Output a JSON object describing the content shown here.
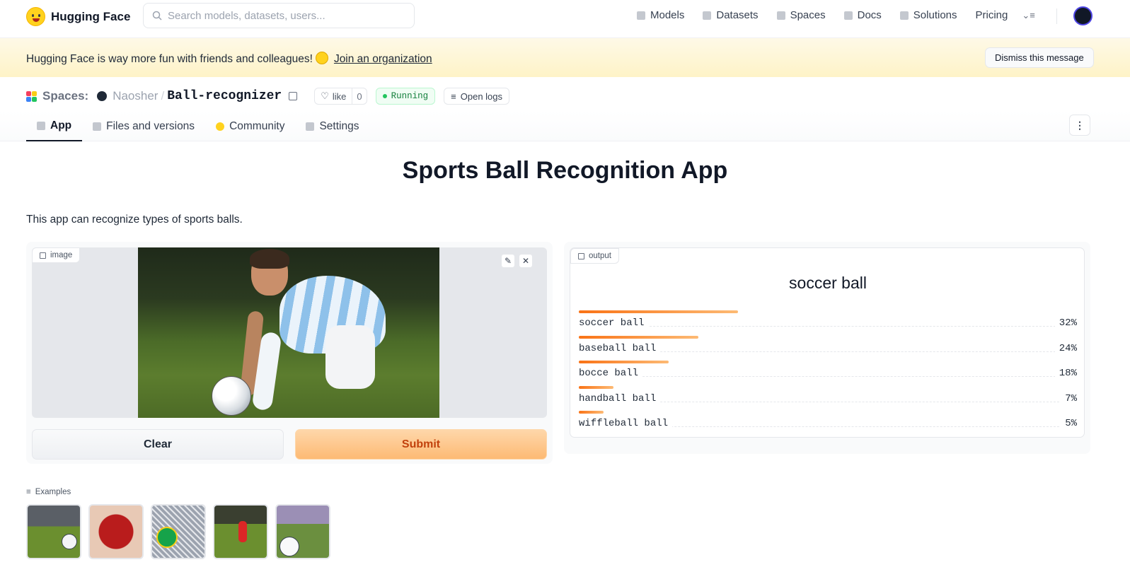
{
  "nav": {
    "brand": "Hugging Face",
    "search_placeholder": "Search models, datasets, users...",
    "links": [
      "Models",
      "Datasets",
      "Spaces",
      "Docs",
      "Solutions",
      "Pricing"
    ]
  },
  "banner": {
    "text": "Hugging Face is way more fun with friends and colleagues!",
    "link": "Join an organization",
    "dismiss": "Dismiss this message"
  },
  "space": {
    "label": "Spaces:",
    "owner": "Naosher",
    "separator": "/",
    "repo": "Ball-recognizer",
    "like_label": "like",
    "like_count": "0",
    "status": "Running",
    "logs": "Open logs"
  },
  "tabs": [
    "App",
    "Files and versions",
    "Community",
    "Settings"
  ],
  "app": {
    "title": "Sports Ball Recognition App",
    "description": "This app can recognize types of sports balls.",
    "input_label": "image",
    "output_label": "output",
    "clear": "Clear",
    "submit": "Submit",
    "prediction": "soccer ball",
    "confidences": [
      {
        "label": "soccer ball",
        "value": "32%",
        "fraction": 0.32
      },
      {
        "label": "baseball ball",
        "value": "24%",
        "fraction": 0.24
      },
      {
        "label": "bocce ball",
        "value": "18%",
        "fraction": 0.18
      },
      {
        "label": "handball ball",
        "value": "7%",
        "fraction": 0.07
      },
      {
        "label": "wiffleball ball",
        "value": "5%",
        "fraction": 0.05
      }
    ],
    "examples_label": "Examples"
  },
  "colors": {
    "accent": "#f97316",
    "running": "#22c55e"
  }
}
